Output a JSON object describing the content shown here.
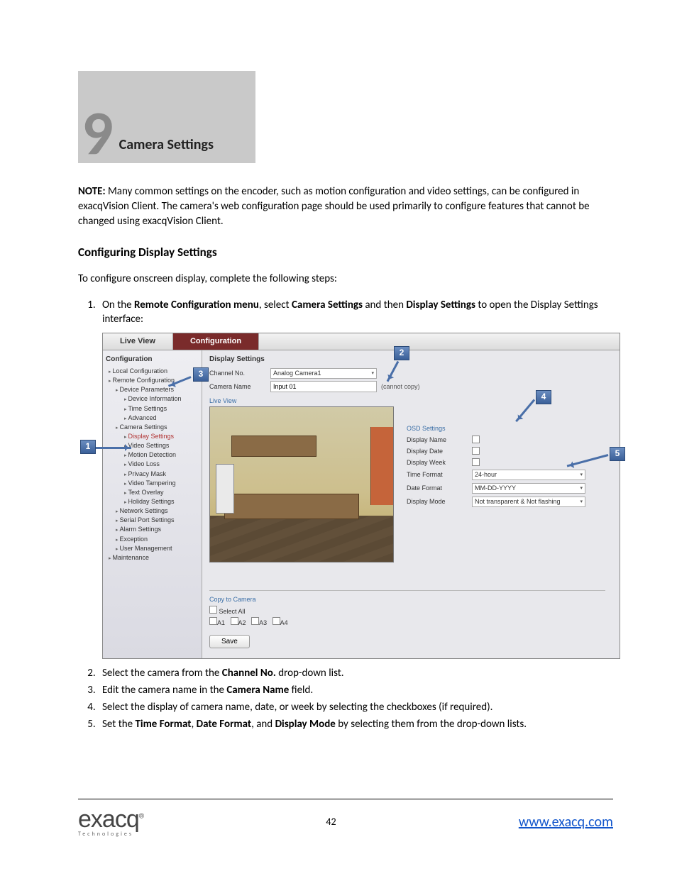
{
  "chapter": {
    "number": "9",
    "title": "Camera Settings"
  },
  "note_label": "NOTE:",
  "note_text": " Many common settings on the encoder, such as motion configuration and video settings, can be configured in exacqVision Client. The camera's web configuration page should be used primarily to configure features that cannot be changed using exacqVision Client.",
  "subhead": "Configuring Display Settings",
  "intro": "To configure onscreen display, complete the following steps:",
  "step1_a": "On the ",
  "step1_b": "Remote Configuration menu",
  "step1_c": ", select ",
  "step1_d": "Camera Settings",
  "step1_e": " and then ",
  "step1_f": "Display Settings",
  "step1_g": " to open the Display Settings interface:",
  "step2_a": "Select the camera from the ",
  "step2_b": "Channel No.",
  "step2_c": " drop-down list.",
  "step3_a": "Edit the camera name in the ",
  "step3_b": "Camera Name",
  "step3_c": " field.",
  "step4": "Select the display of camera name, date, or week by selecting the checkboxes (if required).",
  "step5_a": "Set the ",
  "step5_b": "Time Format",
  "step5_c": ", ",
  "step5_d": "Date Format",
  "step5_e": ", and ",
  "step5_f": "Display Mode",
  "step5_g": " by selecting them from the drop-down lists.",
  "callouts": {
    "c1": "1",
    "c2": "2",
    "c3": "3",
    "c4": "4",
    "c5": "5"
  },
  "ui": {
    "tabs": {
      "live": "Live View",
      "config": "Configuration"
    },
    "tree": {
      "header": "Configuration",
      "local": "Local Configuration",
      "remote": "Remote Configuration",
      "devparams": "Device Parameters",
      "devinfo": "Device Information",
      "time": "Time Settings",
      "adv": "Advanced",
      "camset": "Camera Settings",
      "disp": "Display Settings",
      "video": "Video Settings",
      "motion": "Motion Detection",
      "vloss": "Video Loss",
      "pmask": "Privacy Mask",
      "tamper": "Video Tampering",
      "overlay": "Text Overlay",
      "holiday": "Holiday Settings",
      "network": "Network Settings",
      "serial": "Serial Port Settings",
      "alarm": "Alarm Settings",
      "exc": "Exception",
      "user": "User Management",
      "maint": "Maintenance"
    },
    "panel": {
      "title": "Display Settings",
      "chno_lbl": "Channel No.",
      "chno_val": "Analog Camera1",
      "cname_lbl": "Camera Name",
      "cname_val": "Input 01",
      "cname_hint": "(cannot copy)",
      "live": "Live View",
      "osd_hdr": "OSD Settings",
      "dname": "Display Name",
      "ddate": "Display Date",
      "dweek": "Display Week",
      "tf_lbl": "Time Format",
      "tf_val": "24-hour",
      "df_lbl": "Date Format",
      "df_val": "MM-DD-YYYY",
      "dm_lbl": "Display Mode",
      "dm_val": "Not transparent & Not flashing",
      "copy_hdr": "Copy to Camera",
      "selall": "Select All",
      "a1": "A1",
      "a2": "A2",
      "a3": "A3",
      "a4": "A4",
      "save": "Save"
    }
  },
  "footer": {
    "page": "42",
    "url": "www.exacq.com",
    "logo_top": "exacq",
    "logo_sub": "Technologies",
    "reg": "®"
  }
}
